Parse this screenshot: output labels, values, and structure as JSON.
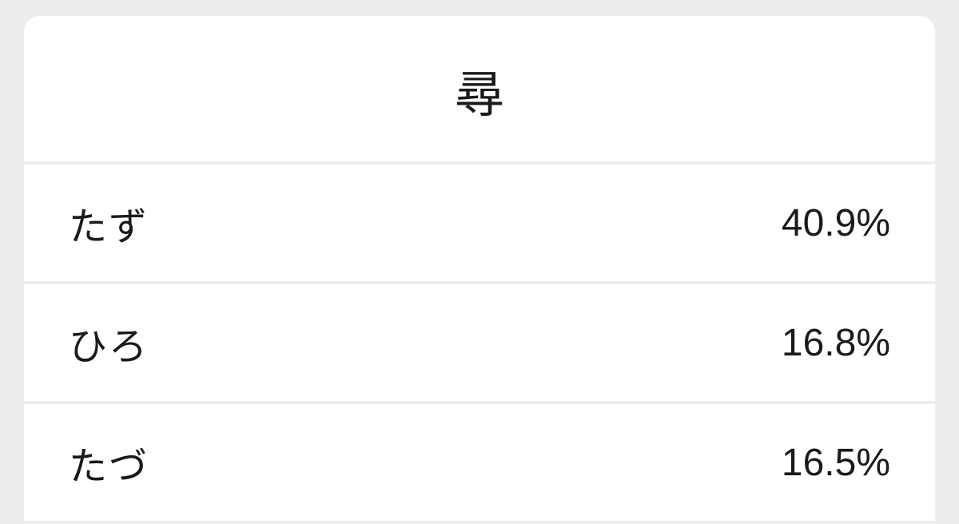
{
  "header": {
    "title": "尋"
  },
  "rows": [
    {
      "reading": "たず",
      "percent": "40.9%"
    },
    {
      "reading": "ひろ",
      "percent": "16.8%"
    },
    {
      "reading": "たづ",
      "percent": "16.5%"
    }
  ]
}
